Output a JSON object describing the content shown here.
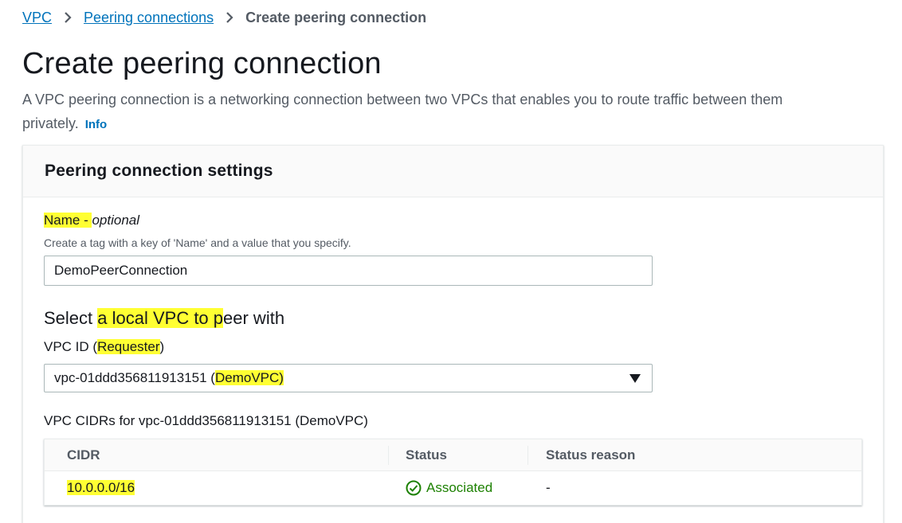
{
  "breadcrumb": {
    "items": [
      "VPC",
      "Peering connections"
    ],
    "current": "Create peering connection"
  },
  "page": {
    "title": "Create peering connection",
    "description": "A VPC peering connection is a networking connection between two VPCs that enables you to route traffic between them privately.",
    "info_link": "Info"
  },
  "settings": {
    "title": "Peering connection settings",
    "name_label": "Name",
    "name_dash": " - ",
    "name_optional": "optional",
    "name_hint": "Create a tag with a key of 'Name' and a value that you specify.",
    "name_value": "DemoPeerConnection",
    "local_heading_pre": "Select ",
    "local_heading_hl": "a local VPC to p",
    "local_heading_post": "eer with",
    "vpc_id_label_pre": "VPC ID (",
    "vpc_id_label_hl": "Requester",
    "vpc_id_label_post": ")",
    "vpc_select_pre": "vpc-01ddd356811913151 (",
    "vpc_select_hl": "DemoVPC)",
    "cidrs_label": "VPC CIDRs for vpc-01ddd356811913151 (DemoVPC)"
  },
  "cidr_table": {
    "columns": [
      "CIDR",
      "Status",
      "Status reason"
    ],
    "rows": [
      {
        "cidr": "10.0.0.0/16",
        "status": "Associated",
        "reason": "-"
      }
    ]
  },
  "colors": {
    "link": "#0073bb",
    "highlight": "#ffff33",
    "success": "#1d8102"
  }
}
